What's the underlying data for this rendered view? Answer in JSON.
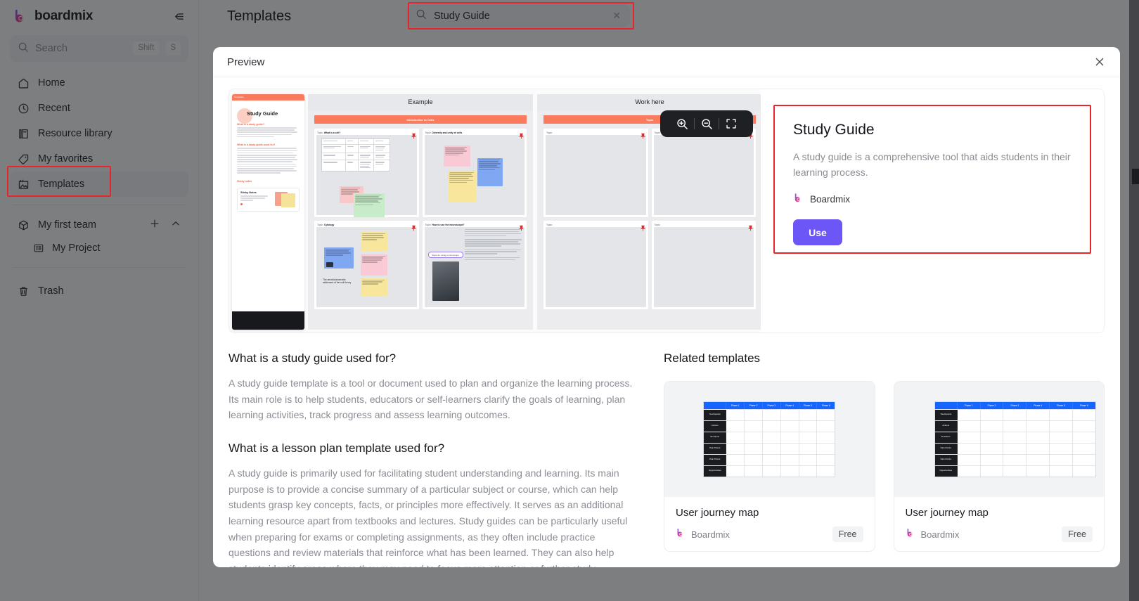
{
  "app": {
    "brand": "boardmix",
    "collapse_icon": "collapse-sidebar-icon"
  },
  "sidebar": {
    "search": {
      "placeholder": "Search",
      "kbd1": "Shift",
      "kbd2": "S",
      "icon": "search-icon"
    },
    "items": [
      {
        "label": "Home",
        "icon": "home-icon"
      },
      {
        "label": "Recent",
        "icon": "clock-icon"
      },
      {
        "label": "Resource library",
        "icon": "library-icon"
      },
      {
        "label": "My favorites",
        "icon": "tag-icon"
      },
      {
        "label": "Templates",
        "icon": "templates-icon"
      }
    ],
    "team": {
      "label": "My first team",
      "icon": "cube-icon",
      "add_icon": "plus-icon",
      "collapse_icon": "chevron-up-icon"
    },
    "project": {
      "label": "My Project",
      "icon": "project-icon"
    },
    "trash": {
      "label": "Trash",
      "icon": "trash-icon"
    }
  },
  "header": {
    "title": "Templates",
    "search": {
      "value": "Study Guide",
      "icon": "search-icon",
      "clear_icon": "close-icon"
    }
  },
  "modal": {
    "title": "Preview",
    "close_icon": "close-icon",
    "zoom_toolbar": {
      "zoom_in_icon": "zoom-in-icon",
      "zoom_out_icon": "zoom-out-icon",
      "fullscreen_icon": "fullscreen-icon"
    },
    "preview": {
      "doc_tag": "Templates",
      "doc_title": "Study Guide",
      "doc_sections": [
        "What is a study guide?",
        "What is a study guide used for?",
        "Sticky notes"
      ],
      "sticky_card_title": "Sticky Notes",
      "panel_example_title": "Example",
      "panel_work_title": "Work here",
      "example_topic_bar": "Introduction to Cells",
      "work_topic_bar": "Topic",
      "example_cells": [
        {
          "prefix": "Topic:",
          "name": "What is a cell?"
        },
        {
          "prefix": "Topic:",
          "name": "Diversity and unity of cells"
        },
        {
          "prefix": "Topic:",
          "name": "Cytology"
        },
        {
          "prefix": "Topic:",
          "name": "How to use the microscope?"
        }
      ],
      "work_cells": [
        {
          "prefix": "Topic:",
          "name": ""
        },
        {
          "prefix": "Topic:",
          "name": ""
        },
        {
          "prefix": "Topic:",
          "name": ""
        },
        {
          "prefix": "Topic:",
          "name": ""
        }
      ],
      "annotation_text": "The aerobic/anaerobic settlement of the soil theory",
      "microscope_caption": "Steps for using a microscope"
    },
    "info": {
      "title": "Study Guide",
      "description": "A study guide is a comprehensive tool that aids students in their learning process.",
      "author": "Boardmix",
      "author_icon": "boardmix-logo-icon",
      "use_label": "Use",
      "accent_color": "#6c56f6"
    },
    "content": {
      "section1_heading": "What is a study guide used for?",
      "section1_body": "A study guide template is a tool or document used to plan and organize the learning process. Its main role is to help students, educators or self-learners clarify the goals of learning, plan learning activities, track progress and assess learning outcomes.",
      "section2_heading": "What is a lesson plan template used for?",
      "section2_body": "A study guide is primarily used for facilitating student understanding and learning. Its main purpose is to provide a concise summary of a particular subject or course, which can help students grasp key concepts, facts, or principles more effectively. It serves as an additional learning resource apart from textbooks and lectures. Study guides can be particularly useful when preparing for exams or completing assignments, as they often include practice questions and review materials that reinforce what has been learned. They can also help students identify areas where they may need to focus more attention or further study."
    },
    "related": {
      "heading": "Related templates",
      "cards": [
        {
          "name": "User journey map",
          "author": "Boardmix",
          "badge": "Free",
          "columns": [
            "",
            "Phase 1",
            "Phase 2",
            "Phase 3",
            "Phase 4",
            "Phase 5",
            "Phase 6"
          ],
          "rows": [
            "Touchpoints",
            "Actions",
            "Emotions",
            "Pain Points",
            "Pain Points",
            "Opportunities"
          ]
        },
        {
          "name": "User journey map",
          "author": "Boardmix",
          "badge": "Free",
          "columns": [
            "",
            "Phase 1",
            "Phase 2",
            "Phase 3",
            "Phase 4",
            "Phase 5",
            "Phase 6"
          ],
          "rows": [
            "Touchpoints",
            "Actions",
            "Emotions",
            "Pain Points",
            "Pain Points",
            "Opportunities"
          ]
        }
      ]
    }
  },
  "highlights": {
    "color": "#e8252a",
    "regions": [
      "templates-nav-item",
      "header-search",
      "template-info-card"
    ]
  }
}
